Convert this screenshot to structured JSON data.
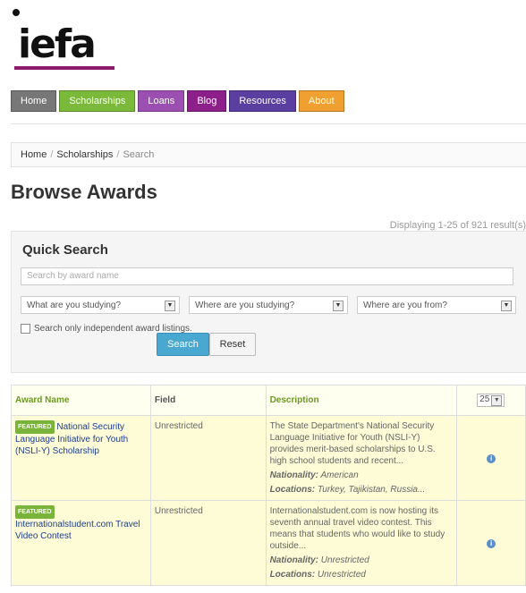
{
  "logo": {
    "text": "iefa"
  },
  "nav": [
    {
      "label": "Home",
      "color": "#777777"
    },
    {
      "label": "Scholarships",
      "color": "#7ab93a"
    },
    {
      "label": "Loans",
      "color": "#9b4fb1"
    },
    {
      "label": "Blog",
      "color": "#8c1f8a"
    },
    {
      "label": "Resources",
      "color": "#5a3ea0"
    },
    {
      "label": "About",
      "color": "#f0a030"
    }
  ],
  "breadcrumb": {
    "home": "Home",
    "sep": "/",
    "scholarships": "Scholarships",
    "current": "Search"
  },
  "page_title": "Browse Awards",
  "result_count": "Displaying 1-25 of 921 result(s)",
  "quick_search": {
    "title": "Quick Search",
    "name_placeholder": "Search by award name",
    "studying": "What are you studying?",
    "where_studying": "Where are you studying?",
    "where_from": "Where are you from?",
    "independent_label": "Search only independent award listings.",
    "search_btn": "Search",
    "reset_btn": "Reset"
  },
  "table": {
    "headers": {
      "award": "Award Name",
      "field": "Field",
      "description": "Description",
      "per_page": "25"
    },
    "rows": [
      {
        "badge": "FEATURED",
        "name": "National Security Language Initiative for Youth (NSLI-Y) Scholarship",
        "field": "Unrestricted",
        "description": "The State Department's National Security Language Initiative for Youth (NSLI-Y) provides merit-based scholarships to U.S. high school students and recent...",
        "nationality_label": "Nationality:",
        "nationality": "American",
        "locations_label": "Locations:",
        "locations": "Turkey, Tajikistan, Russia..."
      },
      {
        "badge": "FEATURED",
        "name": "Internationalstudent.com Travel Video Contest",
        "field": "Unrestricted",
        "description": "Internationalstudent.com is now hosting its seventh annual travel video contest. This means that students who would like to study outside...",
        "nationality_label": "Nationality:",
        "nationality": "Unrestricted",
        "locations_label": "Locations:",
        "locations": "Unrestricted"
      }
    ]
  }
}
